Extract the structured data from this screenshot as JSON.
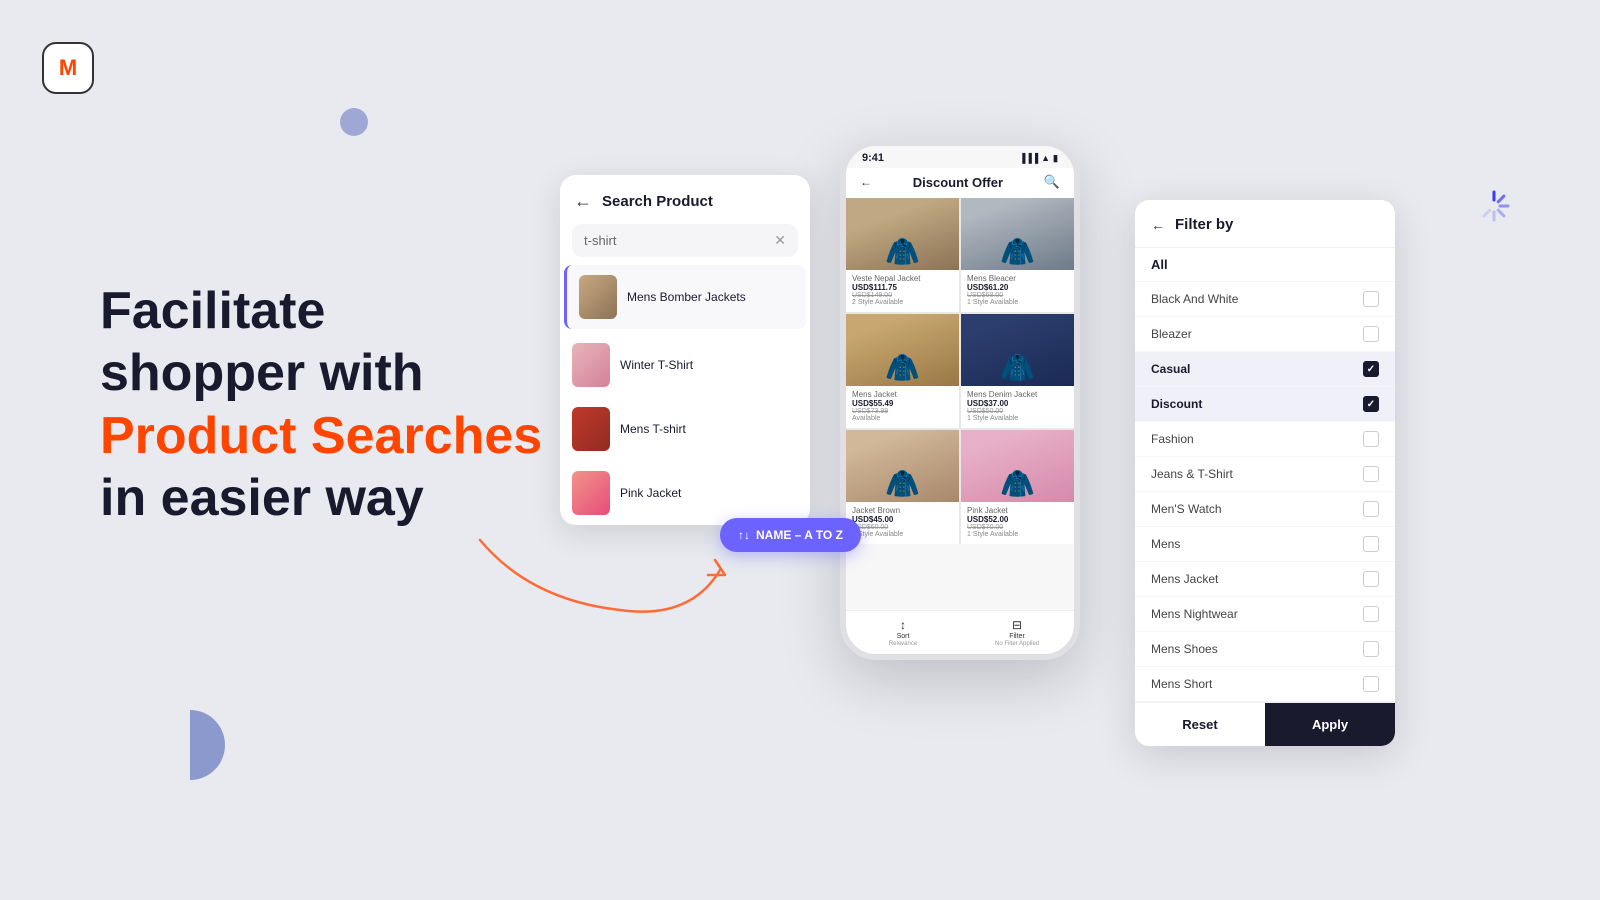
{
  "logo": {
    "letter": "M"
  },
  "hero": {
    "line1": "Facilitate",
    "line2": "shopper with",
    "line3_plain": "",
    "line3_highlight": "Product Searches",
    "line4": "in easier way"
  },
  "search_panel": {
    "title": "Search Product",
    "input_value": "t-shirt",
    "results": [
      {
        "label": "Mens Bomber Jackets",
        "img_class": "result-img-bomber"
      },
      {
        "label": "Winter T-Shirt",
        "img_class": "result-img-winter"
      },
      {
        "label": "Mens T-shirt",
        "img_class": "result-img-mens"
      },
      {
        "label": "Pink Jacket",
        "img_class": "result-img-pink"
      }
    ]
  },
  "sort_badge": {
    "label": "NAME – A TO Z",
    "icon": "↑↓"
  },
  "phone": {
    "status_time": "9:41",
    "header_title": "Discount Offer",
    "products": [
      {
        "name": "Veste Nepal Jacket",
        "price": "USD$111.75",
        "old_price": "USD$149.00",
        "styles": "2 Style Available",
        "img_class": "product-img-1"
      },
      {
        "name": "Mens Bleacer",
        "price": "USD$61.20",
        "old_price": "USD$68.00",
        "styles": "1 Style Available",
        "img_class": "product-img-2"
      },
      {
        "name": "Mens Jacket",
        "price": "USD$55.49",
        "old_price": "USD$73.99",
        "styles": "Available",
        "img_class": "product-img-3"
      },
      {
        "name": "Mens Denim Jacket",
        "price": "USD$37.00",
        "old_price": "USD$50.00",
        "styles": "1 Style Available",
        "img_class": "product-img-4"
      },
      {
        "name": "Jacket Brown",
        "price": "USD$45.00",
        "old_price": "USD$60.00",
        "styles": "2 Style Available",
        "img_class": "product-img-5"
      },
      {
        "name": "Pink Jacket",
        "price": "USD$52.00",
        "old_price": "USD$70.00",
        "styles": "1 Style Available",
        "img_class": "product-img-6"
      }
    ],
    "bottom_tabs": [
      {
        "icon": "↕",
        "label": "Sort",
        "sublabel": "Relevance"
      },
      {
        "icon": "⊟",
        "label": "Filter",
        "sublabel": "No Filter Applied"
      }
    ]
  },
  "filter": {
    "title": "Filter by",
    "items": [
      {
        "label": "All",
        "type": "all",
        "checked": false
      },
      {
        "label": "Black And White",
        "checked": false
      },
      {
        "label": "Bleazer",
        "checked": false
      },
      {
        "label": "Casual",
        "checked": true
      },
      {
        "label": "Discount",
        "checked": true
      },
      {
        "label": "Fashion",
        "checked": false
      },
      {
        "label": "Jeans & T-Shirt",
        "checked": false
      },
      {
        "label": "Men'S Watch",
        "checked": false
      },
      {
        "label": "Mens",
        "checked": false
      },
      {
        "label": "Mens Jacket",
        "checked": false
      },
      {
        "label": "Mens Nightwear",
        "checked": false
      },
      {
        "label": "Mens Shoes",
        "checked": false
      },
      {
        "label": "Mens Short",
        "checked": false
      }
    ],
    "reset_label": "Reset",
    "apply_label": "Apply"
  }
}
